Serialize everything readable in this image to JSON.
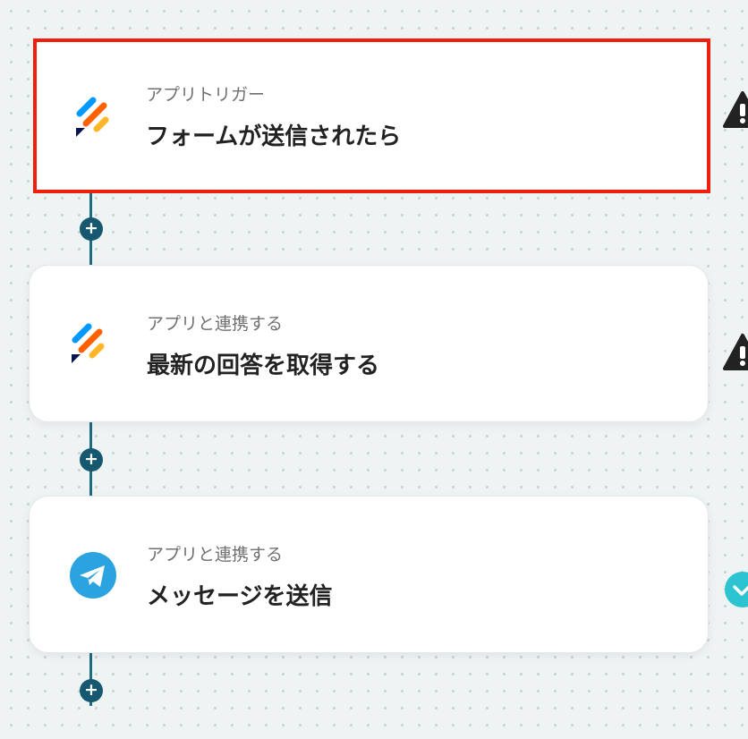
{
  "steps": [
    {
      "type_label": "アプリトリガー",
      "title": "フォームが送信されたら",
      "app_icon": "jotform-icon",
      "status": "warning"
    },
    {
      "type_label": "アプリと連携する",
      "title": "最新の回答を取得する",
      "app_icon": "jotform-icon",
      "status": "warning"
    },
    {
      "type_label": "アプリと連携する",
      "title": "メッセージを送信",
      "app_icon": "telegram-icon",
      "status": "success"
    }
  ],
  "add_step_symbol": "+",
  "colors": {
    "connector": "#1f6b82",
    "selected_border": "#f01e0c",
    "warning": "#222222",
    "success": "#2cc4d0",
    "telegram": "#2aa3e0"
  }
}
